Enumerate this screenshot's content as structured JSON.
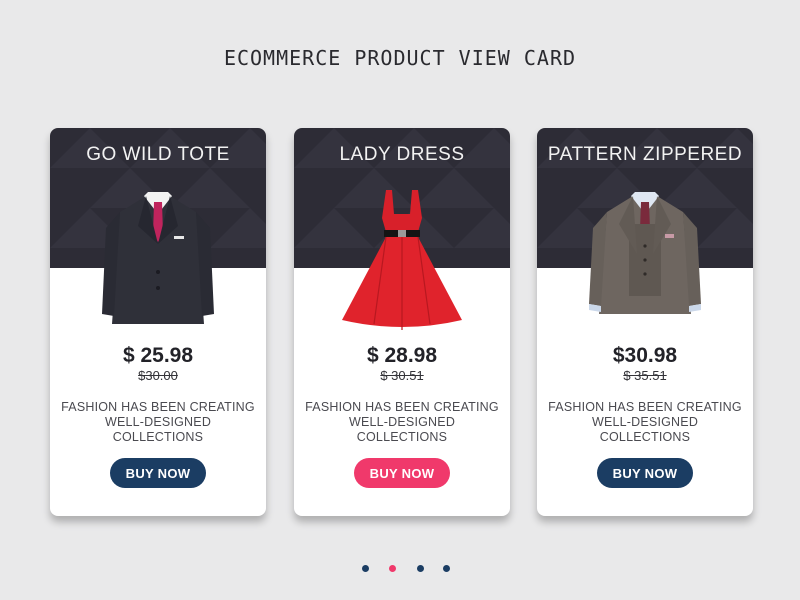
{
  "page": {
    "title": "ECOMMERCE PRODUCT VIEW CARD",
    "background_color": "#e9e9ea"
  },
  "cards": [
    {
      "title": "GO WILD TOTE",
      "price": "$ 25.98",
      "old_price": "$30.00",
      "description_line1": "FASHION HAS BEEN CREATING",
      "description_line2": "WELL-DESIGNED COLLECTIONS",
      "button_label": "BUY NOW",
      "button_color": "#1b3d63",
      "product_image": "dark-suit-image"
    },
    {
      "title": "LADY DRESS",
      "price": "$ 28.98",
      "old_price": "$ 30.51",
      "description_line1": "FASHION HAS BEEN CREATING",
      "description_line2": "WELL-DESIGNED COLLECTIONS",
      "button_label": "BUY NOW",
      "button_color": "#f0396b",
      "product_image": "red-dress-image"
    },
    {
      "title": "PATTERN ZIPPERED",
      "price": "$30.98",
      "old_price": "$ 35.51",
      "description_line1": "FASHION HAS BEEN CREATING",
      "description_line2": "WELL-DESIGNED COLLECTIONS",
      "button_label": "BUY NOW",
      "button_color": "#1b3d63",
      "product_image": "tweed-suit-image"
    }
  ],
  "pagination": {
    "dot_colors": [
      "#1b3d63",
      "#f0396b",
      "#1b3d63",
      "#1b3d63"
    ],
    "active_index": 1
  },
  "colors": {
    "card_header": "#2d2c36",
    "accent_pink": "#f0396b",
    "navy": "#1b3d63"
  }
}
